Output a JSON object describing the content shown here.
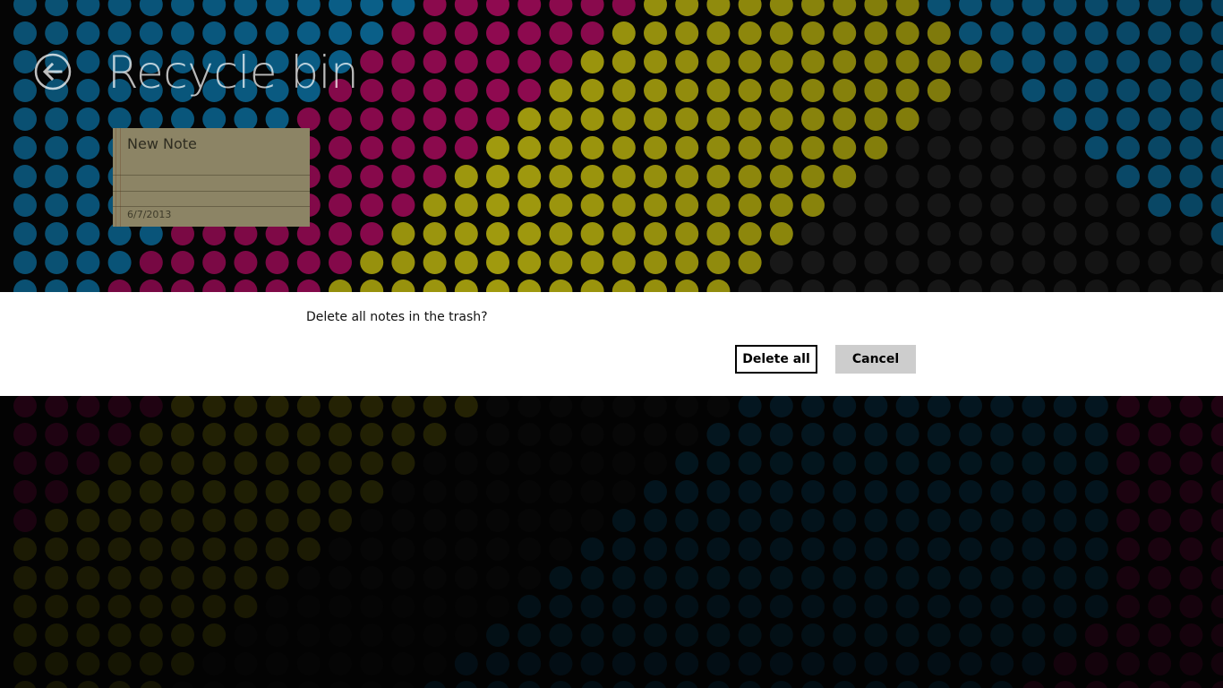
{
  "page": {
    "title": "Recycle bin"
  },
  "background": {
    "base_color": "#050505",
    "dot_colors": {
      "cyan": "#0b6591",
      "magenta": "#8f0a50",
      "yellow": "#a09a0e",
      "gray": "#1b1b1b"
    }
  },
  "notes": [
    {
      "title": "New Note",
      "date": "6/7/2013",
      "color": "#8c8465"
    }
  ],
  "dialog": {
    "message": "Delete all notes in the trash?",
    "delete_all_label": "Delete all",
    "cancel_label": "Cancel"
  },
  "icons": {
    "back": "back-arrow-icon"
  }
}
